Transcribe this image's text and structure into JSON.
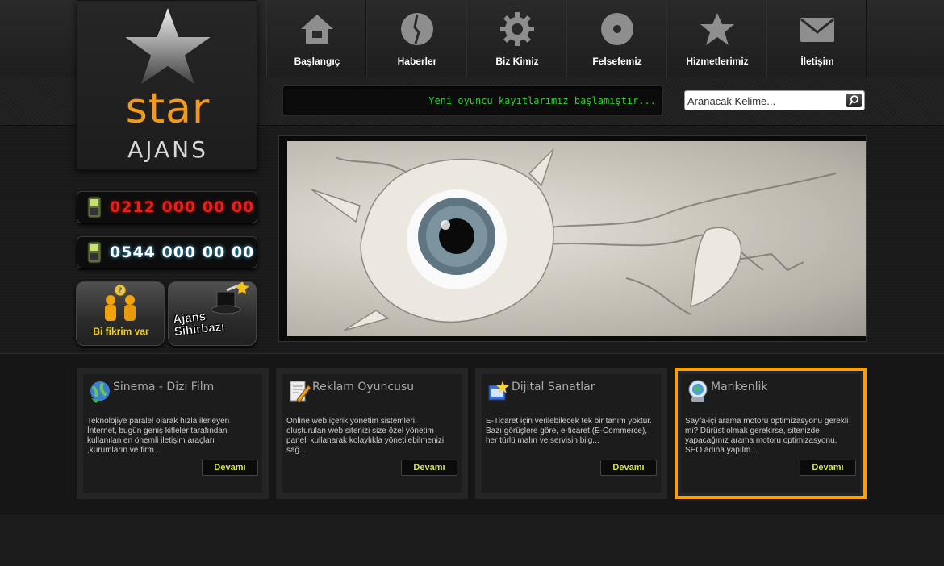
{
  "logo": {
    "brand": "star",
    "sub": "AJANS"
  },
  "nav": [
    {
      "label": "Başlangıç",
      "icon": "home-icon"
    },
    {
      "label": "Haberler",
      "icon": "news-icon"
    },
    {
      "label": "Biz Kimiz",
      "icon": "gear-icon"
    },
    {
      "label": "Felsefemiz",
      "icon": "disc-icon"
    },
    {
      "label": "Hizmetlerimiz",
      "icon": "star-icon"
    },
    {
      "label": "İletişim",
      "icon": "mail-icon"
    }
  ],
  "ticker": {
    "text": "Yeni oyuncu kayıtlarımız başlamıştır..."
  },
  "search": {
    "placeholder": "Aranacak Kelime..."
  },
  "phones": [
    {
      "number": "0212 000 00 00"
    },
    {
      "number": "0544 000 00 00"
    }
  ],
  "buttons": {
    "idea": "Bi fikrim var",
    "wizard_line1": "Ajans",
    "wizard_line2": "Sihirbazı"
  },
  "services": [
    {
      "title": "Sinema - Dizi Film",
      "icon": "globe-icon",
      "text": "Teknolojiye paralel olarak hızla ilerleyen İnternet, bugün geniş kitleler tarafından kullanılan en önemli iletişim araçları ,kurumların ve firm...",
      "button": "Devamı"
    },
    {
      "title": "Reklam Oyuncusu",
      "icon": "edit-icon",
      "text": "Online web içerik yönetim sistemleri, oluşturulan web sitenizi size özel yönetim paneli kullanarak kolaylıkla yönetilebilmenizi sağ...",
      "button": "Devamı"
    },
    {
      "title": "Dijital Sanatlar",
      "icon": "tools-icon",
      "text": "E-Ticaret için verilebilecek tek bir tanım yoktur. Bazı görüşlere göre, e-ticaret (E-Commerce), her türlü malın ve servisin bilg...",
      "button": "Devamı"
    },
    {
      "title": "Mankenlik",
      "icon": "web-search-icon",
      "text": "Sayfa-içi arama motoru optimizasyonu gerekli mi? Dürüst olmak gerekirse, sitenizde yapacağınız arama motoru optimizasyonu, SEO adına yapılm...",
      "button": "Devamı"
    }
  ],
  "colors": {
    "accent": "#f49a1a",
    "highlight_border": "#f7a00c",
    "ticker_text": "#2fd02f",
    "button_text": "#d7e64a"
  }
}
